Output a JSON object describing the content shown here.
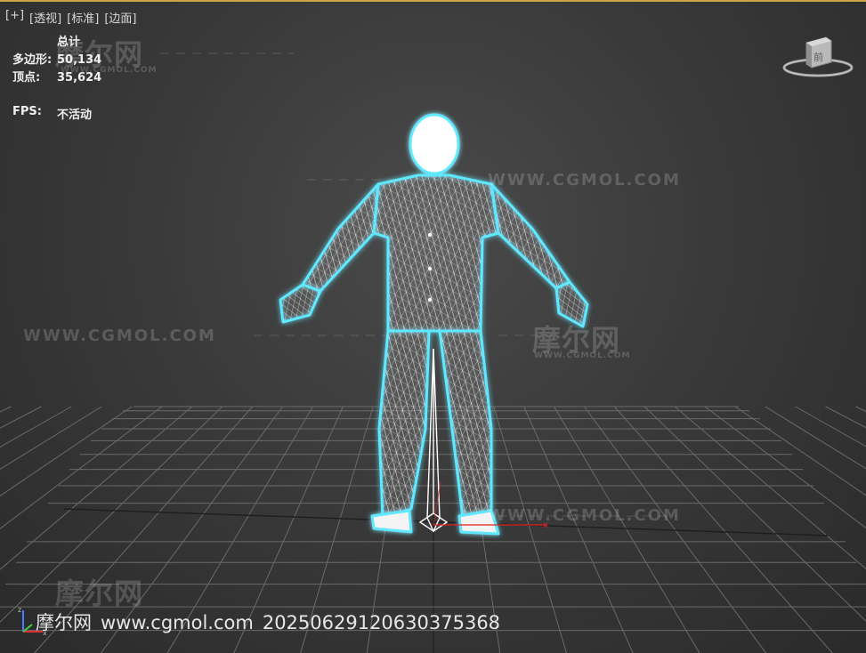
{
  "viewport_menu": [
    "[+]",
    "[透视]",
    "[标准]",
    "[边面]"
  ],
  "stats": {
    "header": "总计",
    "polygons_label": "多边形:",
    "polygons_value": "50,134",
    "vertices_label": "顶点:",
    "vertices_value": "35,624",
    "fps_label": "FPS:",
    "fps_value": "不活动"
  },
  "viewcube": {
    "face_label": "前"
  },
  "watermarks": {
    "url": "WWW.CGMOL.COM",
    "cn": "摩尔网",
    "sub": "WWW.CGMOL.COM"
  },
  "footer": {
    "site_cn": "摩尔网",
    "site_url": "www.cgmol.com",
    "id": "20250629120630375368"
  },
  "colors": {
    "accent_border": "#c9a54a",
    "mesh_glow": "#5fe8ff",
    "wire": "#ffffff",
    "grid": "#6a6a6a"
  }
}
